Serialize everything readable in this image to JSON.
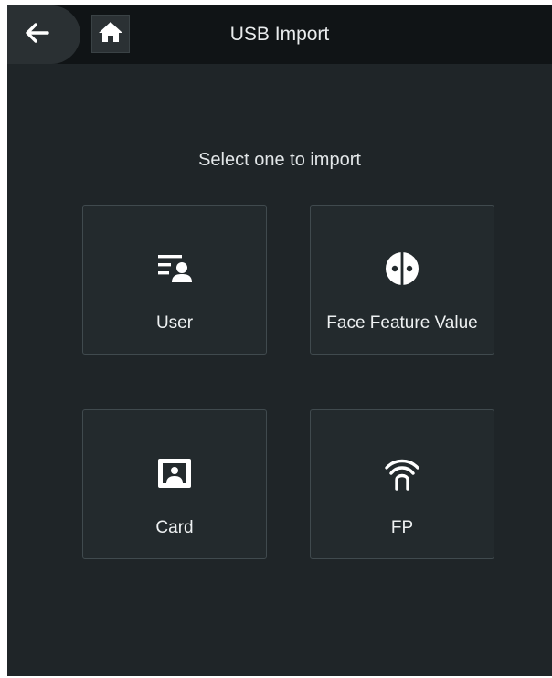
{
  "header": {
    "title": "USB Import",
    "back_icon": "arrow-left-icon",
    "home_icon": "home-icon"
  },
  "main": {
    "prompt": "Select one to import",
    "options": [
      {
        "label": "User",
        "icon": "user-list-icon"
      },
      {
        "label": "Face Feature Value",
        "icon": "face-icon"
      },
      {
        "label": "Card",
        "icon": "card-icon"
      },
      {
        "label": "FP",
        "icon": "fingerprint-icon"
      }
    ]
  },
  "colors": {
    "background": "#1f2528",
    "header": "#101416",
    "tile": "#232a2d",
    "tile_border": "#404a4e",
    "text": "#eef1f2"
  }
}
